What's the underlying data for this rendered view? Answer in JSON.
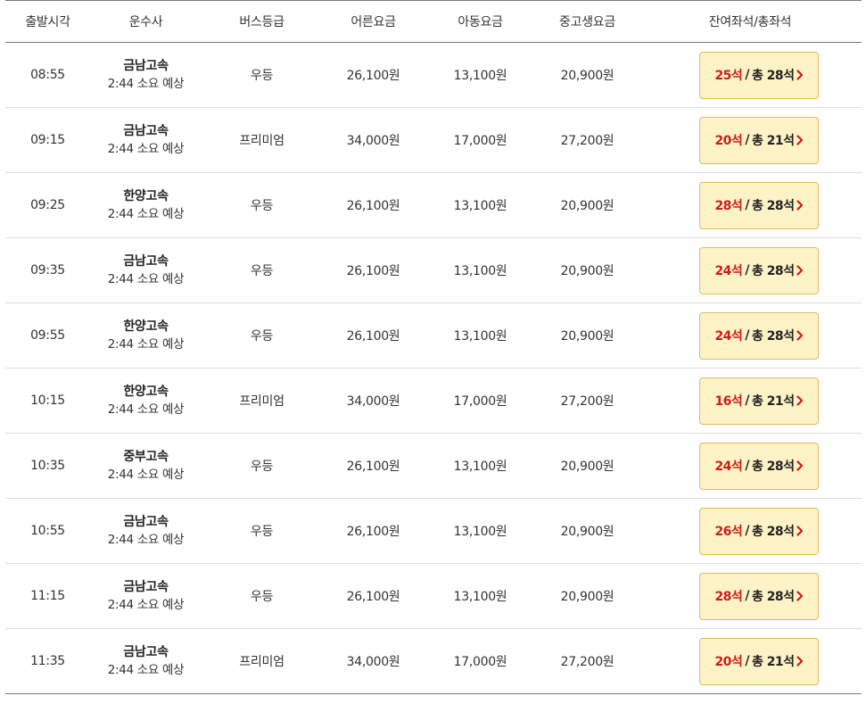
{
  "headers": [
    "출발시각",
    "운수사",
    "버스등급",
    "어른요금",
    "아동요금",
    "중고생요금",
    "잔여좌석/총좌석"
  ],
  "seat_separator": "/",
  "rows": [
    {
      "time": "08:55",
      "company": "금남고속",
      "duration": "2:44 소요 예상",
      "grade": "우등",
      "adult": "26,100원",
      "child": "13,100원",
      "student": "20,900원",
      "remaining": "25석",
      "total": "총 28석"
    },
    {
      "time": "09:15",
      "company": "금남고속",
      "duration": "2:44 소요 예상",
      "grade": "프리미엄",
      "adult": "34,000원",
      "child": "17,000원",
      "student": "27,200원",
      "remaining": "20석",
      "total": "총 21석"
    },
    {
      "time": "09:25",
      "company": "한양고속",
      "duration": "2:44 소요 예상",
      "grade": "우등",
      "adult": "26,100원",
      "child": "13,100원",
      "student": "20,900원",
      "remaining": "28석",
      "total": "총 28석"
    },
    {
      "time": "09:35",
      "company": "금남고속",
      "duration": "2:44 소요 예상",
      "grade": "우등",
      "adult": "26,100원",
      "child": "13,100원",
      "student": "20,900원",
      "remaining": "24석",
      "total": "총 28석"
    },
    {
      "time": "09:55",
      "company": "한양고속",
      "duration": "2:44 소요 예상",
      "grade": "우등",
      "adult": "26,100원",
      "child": "13,100원",
      "student": "20,900원",
      "remaining": "24석",
      "total": "총 28석"
    },
    {
      "time": "10:15",
      "company": "한양고속",
      "duration": "2:44 소요 예상",
      "grade": "프리미엄",
      "adult": "34,000원",
      "child": "17,000원",
      "student": "27,200원",
      "remaining": "16석",
      "total": "총 21석"
    },
    {
      "time": "10:35",
      "company": "중부고속",
      "duration": "2:44 소요 예상",
      "grade": "우등",
      "adult": "26,100원",
      "child": "13,100원",
      "student": "20,900원",
      "remaining": "24석",
      "total": "총 28석"
    },
    {
      "time": "10:55",
      "company": "금남고속",
      "duration": "2:44 소요 예상",
      "grade": "우등",
      "adult": "26,100원",
      "child": "13,100원",
      "student": "20,900원",
      "remaining": "26석",
      "total": "총 28석"
    },
    {
      "time": "11:15",
      "company": "금남고속",
      "duration": "2:44 소요 예상",
      "grade": "우등",
      "adult": "26,100원",
      "child": "13,100원",
      "student": "20,900원",
      "remaining": "28석",
      "total": "총 28석"
    },
    {
      "time": "11:35",
      "company": "금남고속",
      "duration": "2:44 소요 예상",
      "grade": "프리미엄",
      "adult": "34,000원",
      "child": "17,000원",
      "student": "27,200원",
      "remaining": "20석",
      "total": "총 21석"
    }
  ],
  "icons": {
    "seat_arrow": "chevron-right-icon"
  },
  "colors": {
    "seat_button_bg": "#fdf3c6",
    "seat_button_border": "#e2b95f",
    "remaining_text": "#d01b1b"
  }
}
